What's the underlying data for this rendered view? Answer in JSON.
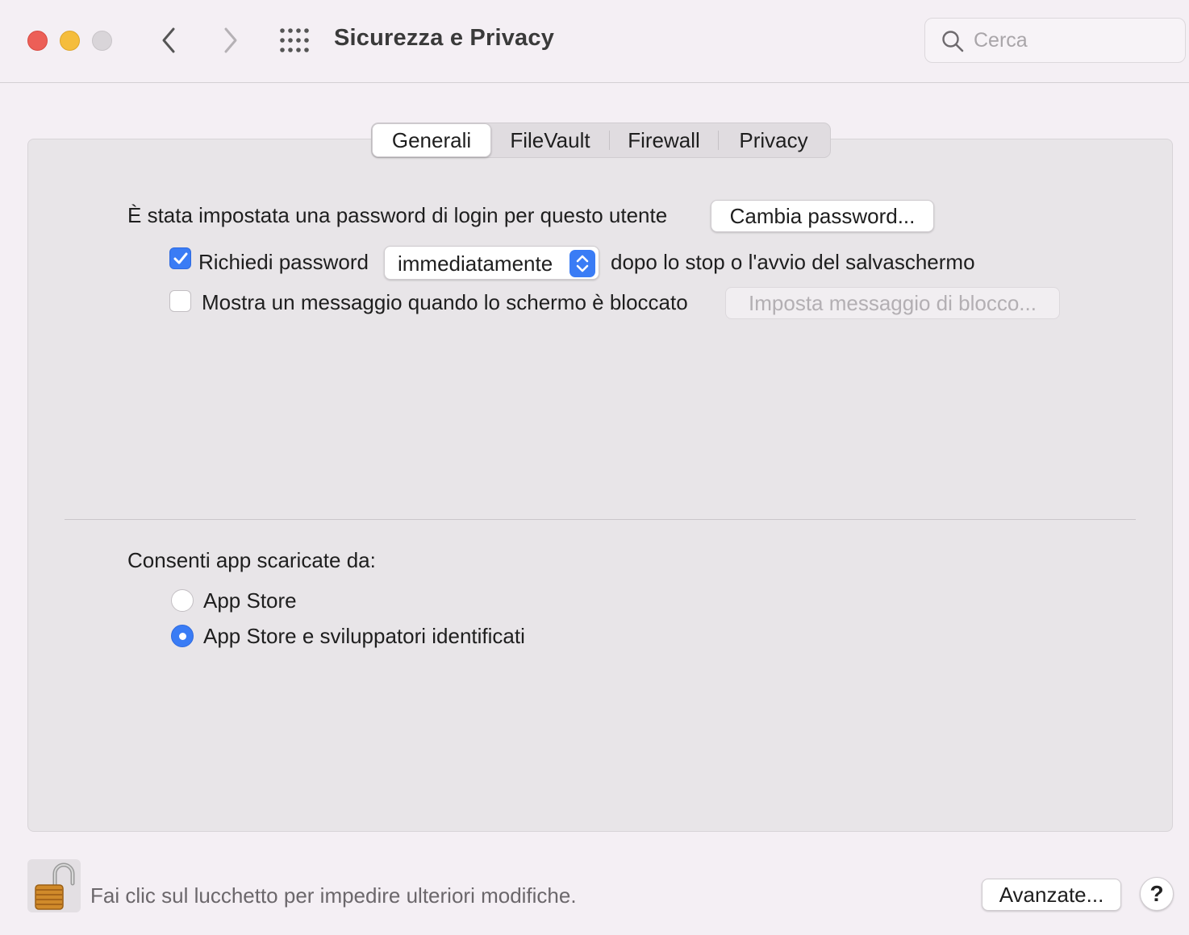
{
  "window": {
    "title": "Sicurezza e Privacy",
    "search_placeholder": "Cerca"
  },
  "toolbar": {
    "back_icon": "chevron-left-icon",
    "forward_icon": "chevron-right-icon",
    "show_all_icon": "grid-icon"
  },
  "tabs": [
    {
      "label": "Generali",
      "active": true
    },
    {
      "label": "FileVault",
      "active": false
    },
    {
      "label": "Firewall",
      "active": false
    },
    {
      "label": "Privacy",
      "active": false
    }
  ],
  "general": {
    "password_set_text": "È stata impostata una password di login per questo utente",
    "change_password_button": "Cambia password...",
    "require_password": {
      "label": "Richiedi password",
      "checked": true,
      "select_value": "immediatamente",
      "suffix": "dopo lo stop o l'avvio del salvaschermo"
    },
    "show_message": {
      "label": "Mostra un messaggio quando lo schermo è bloccato",
      "checked": false,
      "button": "Imposta messaggio di blocco..."
    }
  },
  "allow_apps": {
    "heading": "Consenti app scaricate da:",
    "options": [
      {
        "label": "App Store",
        "selected": false
      },
      {
        "label": "App Store e sviluppatori identificati",
        "selected": true
      }
    ]
  },
  "footer": {
    "lock_text": "Fai clic sul lucchetto per impedire ulteriori modifiche.",
    "advanced_button": "Avanzate...",
    "help_label": "?"
  },
  "colors": {
    "accent": "#3a7cf5",
    "close": "#ec5f57",
    "minimize": "#f5bd3c"
  }
}
